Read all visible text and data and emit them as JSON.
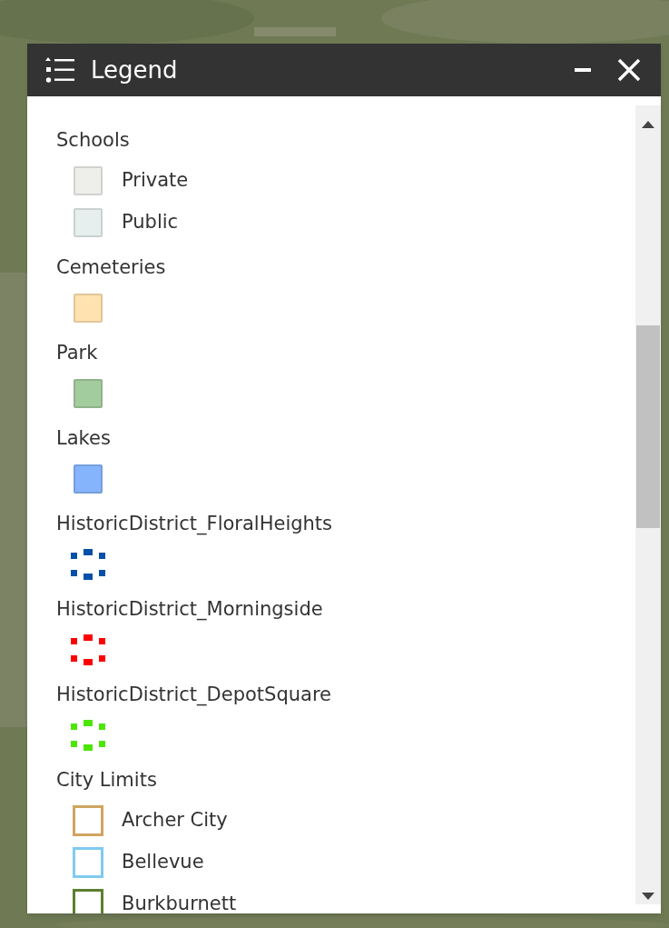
{
  "window": {
    "title": "Legend"
  },
  "layers": [
    {
      "title": "Schools",
      "symbols": [
        {
          "kind": "fill",
          "color": "#eeefea",
          "label": "Private"
        },
        {
          "kind": "fill",
          "color": "#e6eeee",
          "label": "Public"
        }
      ]
    },
    {
      "title": "Cemeteries",
      "symbols": [
        {
          "kind": "fill",
          "color": "#ffe2b0"
        }
      ]
    },
    {
      "title": "Park",
      "symbols": [
        {
          "kind": "fill",
          "color": "#a3cc9e"
        }
      ]
    },
    {
      "title": "Lakes",
      "symbols": [
        {
          "kind": "fill",
          "color": "#86b4fc"
        }
      ]
    },
    {
      "title": "HistoricDistrict_FloralHeights",
      "symbols": [
        {
          "kind": "dashed",
          "color": "#0250a8"
        }
      ]
    },
    {
      "title": "HistoricDistrict_Morningside",
      "symbols": [
        {
          "kind": "dashed",
          "color": "#fe0000"
        }
      ]
    },
    {
      "title": "HistoricDistrict_DepotSquare",
      "symbols": [
        {
          "kind": "dashed",
          "color": "#4ce600"
        }
      ]
    },
    {
      "title": "City Limits",
      "symbols": [
        {
          "kind": "outline",
          "color": "#cfa560",
          "label": "Archer City"
        },
        {
          "kind": "outline",
          "color": "#7fcbef",
          "label": "Bellevue"
        },
        {
          "kind": "outline",
          "color": "#5b7f2f",
          "label": "Burkburnett"
        }
      ]
    }
  ]
}
